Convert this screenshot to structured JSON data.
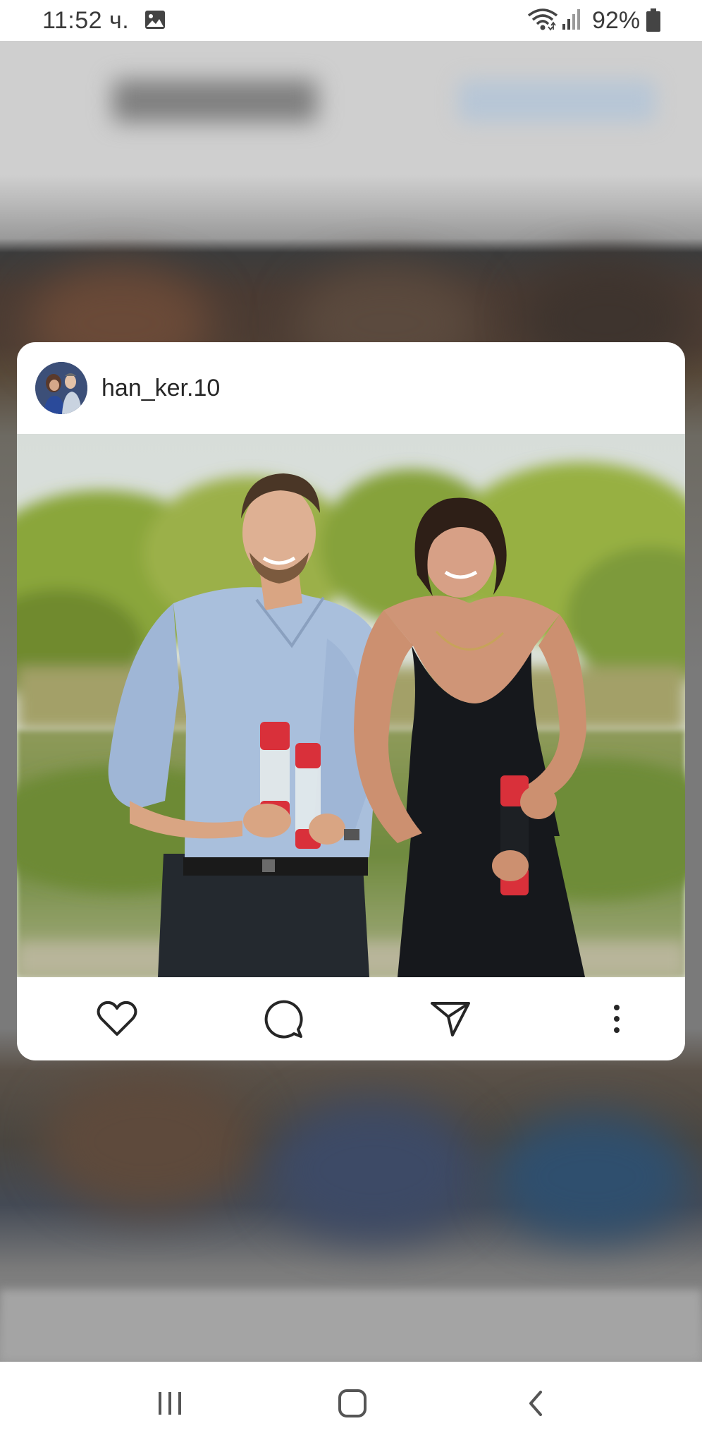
{
  "status_bar": {
    "time": "11:52 ч.",
    "battery_percent": "92%",
    "icons": [
      "gallery-icon",
      "wifi-icon",
      "signal-icon",
      "battery-icon"
    ]
  },
  "post": {
    "username": "han_ker.10",
    "actions": [
      "heart-icon",
      "comment-icon",
      "share-icon",
      "more-icon"
    ]
  },
  "navigation": {
    "buttons": [
      "recent-apps-icon",
      "home-icon",
      "back-icon"
    ]
  },
  "colors": {
    "card_background": "#ffffff",
    "text_primary": "#262626",
    "overlay_background": "#8a8a8a"
  }
}
